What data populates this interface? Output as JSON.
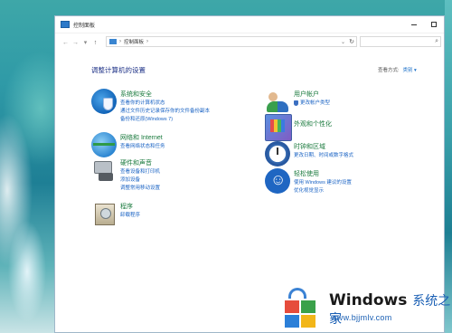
{
  "window": {
    "title": "控制面板"
  },
  "address": {
    "path": "控制面板"
  },
  "main": {
    "heading": "调整计算机的设置",
    "view_by_label": "查看方式:",
    "view_by_value": "类别 ▾"
  },
  "categories_left": [
    {
      "icon": "shield-icon",
      "title": "系统和安全",
      "links": [
        "查看你的计算机状态",
        "通过文件历史记录保存你的文件备份副本",
        "备份和还原(Windows 7)"
      ]
    },
    {
      "icon": "network-icon",
      "title": "网络和 Internet",
      "links": [
        "查看网络状态和任务"
      ]
    },
    {
      "icon": "printer-icon",
      "title": "硬件和声音",
      "links": [
        "查看设备和打印机",
        "添加设备",
        "调整常用移动设置"
      ]
    },
    {
      "icon": "programs-icon",
      "title": "程序",
      "links": [
        "卸载程序"
      ]
    }
  ],
  "categories_right": [
    {
      "icon": "user-accounts-icon",
      "title": "用户帐户",
      "links": [
        "更改帐户类型"
      ]
    },
    {
      "icon": "appearance-icon",
      "title": "外观和个性化",
      "links": []
    },
    {
      "icon": "clock-icon",
      "title": "时钟和区域",
      "links": [
        "更改日期、时间或数字格式"
      ]
    },
    {
      "icon": "ease-of-access-icon",
      "title": "轻松使用",
      "links": [
        "使用 Windows 建议的设置",
        "优化视觉显示"
      ]
    }
  ],
  "watermark": {
    "title": "Windows",
    "title_cn": "系统之家",
    "url": "www.bjjmlv.com"
  }
}
